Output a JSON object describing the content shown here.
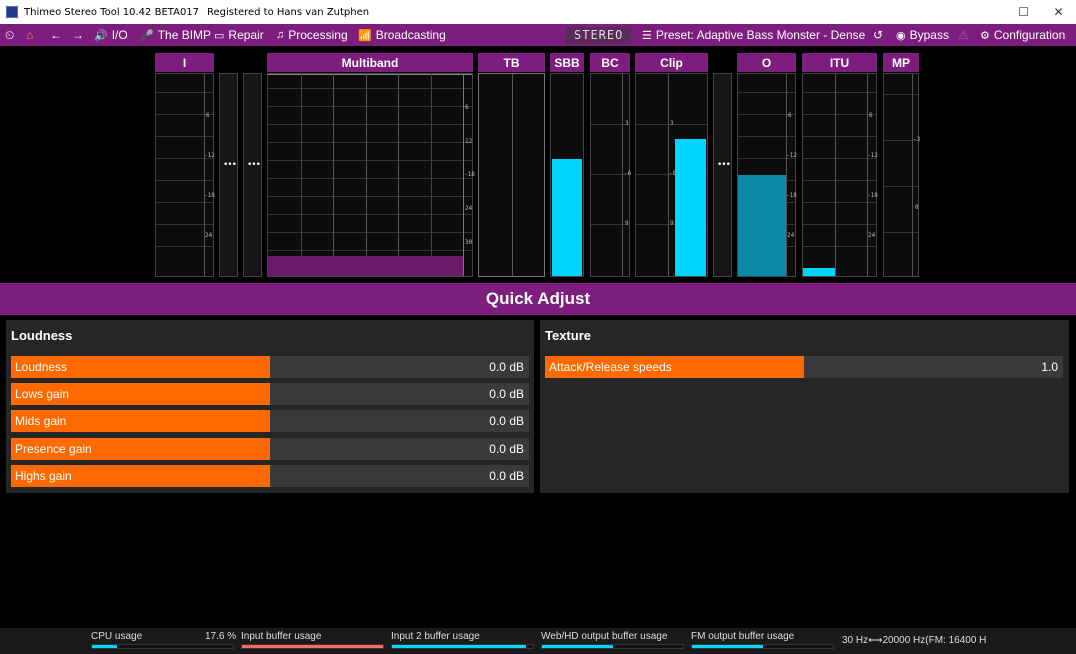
{
  "titlebar": {
    "title": "Thimeo Stereo Tool 10.42 BETA017",
    "registered": "Registered to Hans van Zutphen",
    "maximize": "☐",
    "close": "✕"
  },
  "toolbar": {
    "io": "I/O",
    "bimp": "The BIMP",
    "repair": "Repair",
    "processing": "Processing",
    "broadcasting": "Broadcasting",
    "stereo": "STEREO",
    "preset": "Preset: Adaptive Bass Monster - Dense",
    "bypass": "Bypass",
    "configuration": "Configuration"
  },
  "meters": {
    "i": "I",
    "multiband": "Multiband",
    "tb": "TB",
    "sbb": "SBB",
    "bc": "BC",
    "clip": "Clip",
    "o": "O",
    "itu": "ITU",
    "mp": "MP",
    "dots": "•••",
    "ticks_i": [
      "6",
      "-12",
      "-18",
      "24"
    ],
    "ticks_mb": [
      "6",
      "12",
      "-18",
      "24",
      "30"
    ],
    "ticks_bc": [
      "3",
      "-6",
      "9"
    ],
    "ticks_clip": [
      "3",
      "-6",
      "9"
    ],
    "ticks_o": [
      "6",
      "-12",
      "-18",
      "24"
    ],
    "ticks_itu": [
      "6",
      "-12",
      "-18",
      "24"
    ],
    "ticks_mp": [
      "-3",
      "0"
    ],
    "levels": {
      "sbb": 0.58,
      "clip": 0.68,
      "o": 0.5,
      "itu": 0.04,
      "mb": 0.1
    },
    "colors": {
      "cyan": "#00d4ff",
      "teal": "#0a8aa8",
      "purple": "#6a1a6a"
    }
  },
  "quick_adjust": {
    "title": "Quick Adjust",
    "loudness": {
      "title": "Loudness",
      "items": [
        {
          "label": "Loudness",
          "value": "0.0 dB",
          "fill": 0.5
        },
        {
          "label": "Lows gain",
          "value": "0.0 dB",
          "fill": 0.5
        },
        {
          "label": "Mids gain",
          "value": "0.0 dB",
          "fill": 0.5
        },
        {
          "label": "Presence gain",
          "value": "0.0 dB",
          "fill": 0.5
        },
        {
          "label": "Highs gain",
          "value": "0.0 dB",
          "fill": 0.5
        }
      ]
    },
    "texture": {
      "title": "Texture",
      "items": [
        {
          "label": "Attack/Release speeds",
          "value": "1.0",
          "fill": 0.5
        }
      ]
    }
  },
  "status": {
    "cpu": "CPU usage",
    "cpu_value": "17.6 %",
    "input": "Input buffer usage",
    "input2": "Input 2 buffer usage",
    "webhd": "Web/HD output buffer usage",
    "fm": "FM output buffer usage",
    "range": "30 Hz⟷20000 Hz(FM: 16400 H",
    "cpu_level": 0.176,
    "input_level": 1.0,
    "input2_level": 0.95,
    "webhd_level": 0.5,
    "fm_level": 0.5
  }
}
